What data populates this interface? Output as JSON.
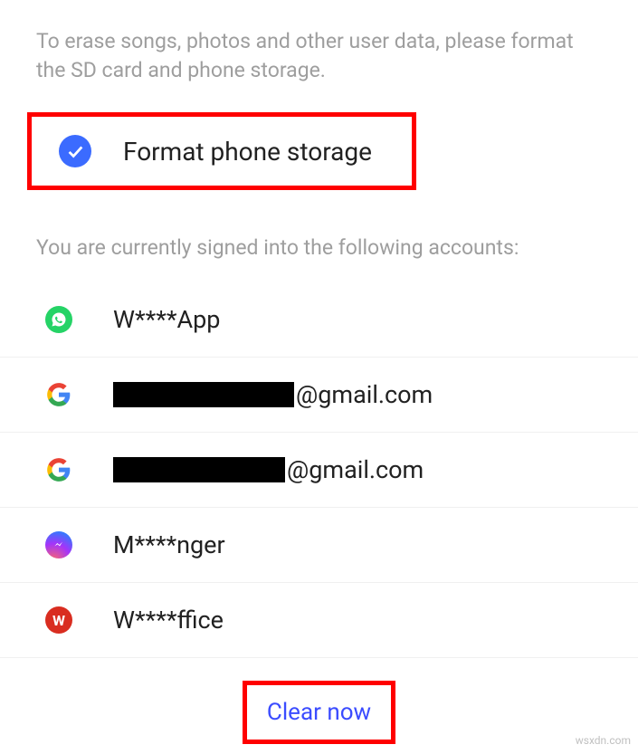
{
  "description": "To erase songs, photos and other user data, please format the SD card and phone storage.",
  "format_option": {
    "label": "Format phone storage",
    "checked": true
  },
  "accounts_header": "You are currently signed into the following accounts:",
  "accounts": [
    {
      "icon": "whatsapp",
      "label": "W****App",
      "redacted_width": 0,
      "suffix": ""
    },
    {
      "icon": "google",
      "label": "",
      "redacted_width": 200,
      "suffix": "@gmail.com"
    },
    {
      "icon": "google",
      "label": "",
      "redacted_width": 190,
      "suffix": "@gmail.com"
    },
    {
      "icon": "messenger",
      "label": "M****nger",
      "redacted_width": 0,
      "suffix": ""
    },
    {
      "icon": "wps",
      "label": "W****ffice",
      "redacted_width": 0,
      "suffix": ""
    }
  ],
  "clear_button": "Clear now",
  "watermark": "wsxdn.com",
  "colors": {
    "accent_blue": "#3b6bff",
    "highlight_red": "#ff0000",
    "text_gray": "#9e9e9e",
    "text_dark": "#212121"
  }
}
